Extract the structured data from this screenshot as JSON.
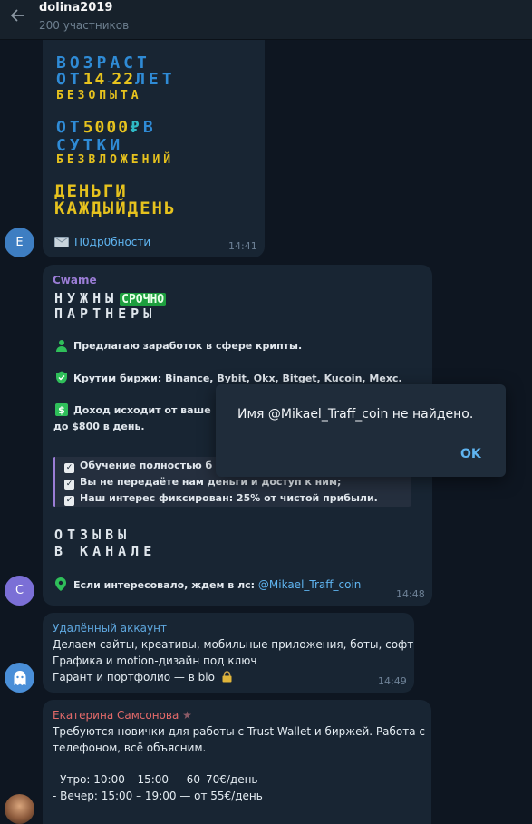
{
  "header": {
    "title": "dolina2019",
    "subtitle": "200 участников"
  },
  "msg1": {
    "avatar_letter": "E",
    "lines": {
      "l1": "ВОЗРАСТ",
      "l2a": "ОТ",
      "l2b": "14",
      "l2c": "-",
      "l2d": "22",
      "l2e": "ЛЕТ",
      "l3": "БЕЗОПЫТА",
      "l4a": "ОТ",
      "l4b": "5000",
      "l4c": "₽",
      "l4d": "В",
      "l5": "СУТКИ",
      "l6": "БЕЗВЛОЖЕНИЙ",
      "l7": "ДЕНЬГИ",
      "l8": "КАЖДЫЙДЕНЬ"
    },
    "link": "П0др0бности",
    "time": "14:41"
  },
  "msg2": {
    "sender": "Cwame",
    "h1": "НУЖНЫ",
    "h1_badge": "СРОЧНО",
    "h2": "ПАРТНЕРЫ",
    "p1": "Предлагаю заработок в сфере крипты.",
    "p2": "Крутим биржи: Binance, Bybit, Okx, Bitget, Kucoin, Mexc.",
    "p3a": "Доход исходит от ваше",
    "p3b": "до $800 в день.",
    "q1": "Обучение полностью б",
    "q2": "Вы не передаёте нам деньги и доступ к ним;",
    "q3": "Наш интерес фиксирован: 25% от чистой прибыли.",
    "h3": "ОТЗЫВЫ",
    "h4": "В КАНАЛЕ",
    "contact": "Если интересовало, ждем в лс: ",
    "contact_handle": "@Mikael_Traff_coin",
    "time": "14:48",
    "avatar_letter": "C"
  },
  "msg3": {
    "sender": "Удалённый аккаунт",
    "l1": "Делаем сайты, креативы, мобильные приложения, боты, софт",
    "l2": "Графика и motion-дизайн под ключ",
    "l3": "Гарант и портфолио — в bio",
    "time": "14:49"
  },
  "msg4": {
    "sender": "Екатерина Самсонова",
    "star": "★",
    "l1": "Требуются новички для работы с Trust Wallet и биржей. Работа с",
    "l2": "телефоном, всё объясним.",
    "l3": "- Утро: 10:00 – 15:00 — 60–70€/день",
    "l4": "- Вечер: 15:00 – 19:00 — от 55€/день"
  },
  "dialog": {
    "message": "Имя @Mikael_Traff_coin не найдено.",
    "ok": "OK"
  },
  "colors": {
    "background": "#0e1621",
    "bubble": "#182533",
    "accent_blue": "#5fb4f0",
    "ad_blue": "#2f8bd6",
    "ad_yellow": "#e6c21e",
    "sender_cwame": "#9b7dd6",
    "sender_deleted": "#5fa8e0",
    "sender_ekaterina": "#e46a6a",
    "badge_green": "#1d9e3e"
  }
}
